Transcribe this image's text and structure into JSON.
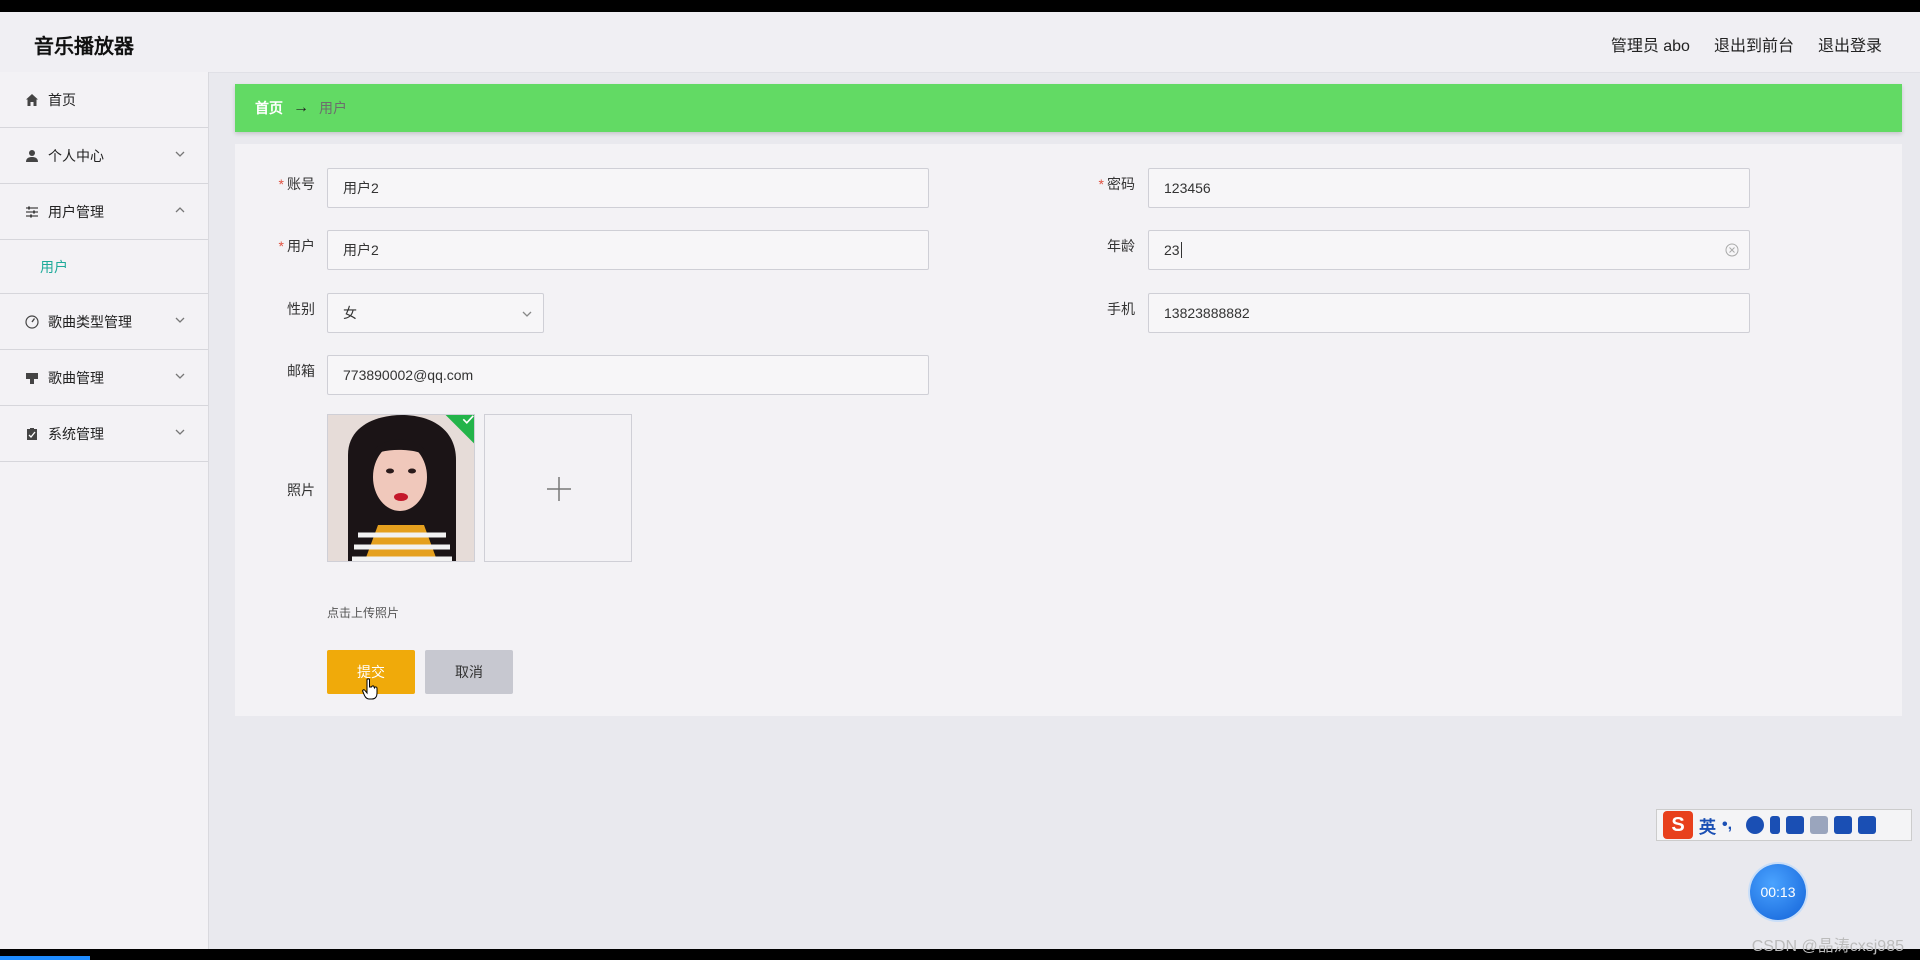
{
  "header": {
    "app_title": "音乐播放器",
    "admin_label": "管理员 abo",
    "back_to_front": "退出到前台",
    "logout": "退出登录"
  },
  "sidebar": {
    "items": [
      {
        "label": "首页",
        "icon": "home-icon"
      },
      {
        "label": "个人中心",
        "icon": "user-icon"
      },
      {
        "label": "用户管理",
        "icon": "sliders-icon",
        "expanded": true,
        "children": [
          {
            "label": "用户"
          }
        ]
      },
      {
        "label": "歌曲类型管理",
        "icon": "gauge-icon"
      },
      {
        "label": "歌曲管理",
        "icon": "stamp-icon"
      },
      {
        "label": "系统管理",
        "icon": "clipboard-icon"
      }
    ]
  },
  "breadcrumb": {
    "home": "首页",
    "arrow": "→",
    "current": "用户"
  },
  "form": {
    "account": {
      "label": "账号",
      "value": "用户2",
      "required": true
    },
    "password": {
      "label": "密码",
      "value": "123456",
      "required": true
    },
    "username": {
      "label": "用户",
      "value": "用户2",
      "required": true
    },
    "age": {
      "label": "年龄",
      "value": "23"
    },
    "gender": {
      "label": "性别",
      "value": "女"
    },
    "phone": {
      "label": "手机",
      "value": "13823888882"
    },
    "email": {
      "label": "邮箱",
      "value": "773890002@qq.com"
    },
    "photo": {
      "label": "照片",
      "upload_tip": "点击上传照片"
    },
    "submit_label": "提交",
    "cancel_label": "取消"
  },
  "overlay": {
    "ime_logo": "S",
    "ime_mode": "英",
    "timer": "00:13",
    "watermark": "CSDN @晶涛cxsj985"
  },
  "colors": {
    "breadcrumb_bg": "#62da64",
    "submit_bg": "#f0aa0a",
    "cancel_bg": "#c7c8d0",
    "active_sub": "#1eaa9a",
    "required": "#e0503f"
  }
}
